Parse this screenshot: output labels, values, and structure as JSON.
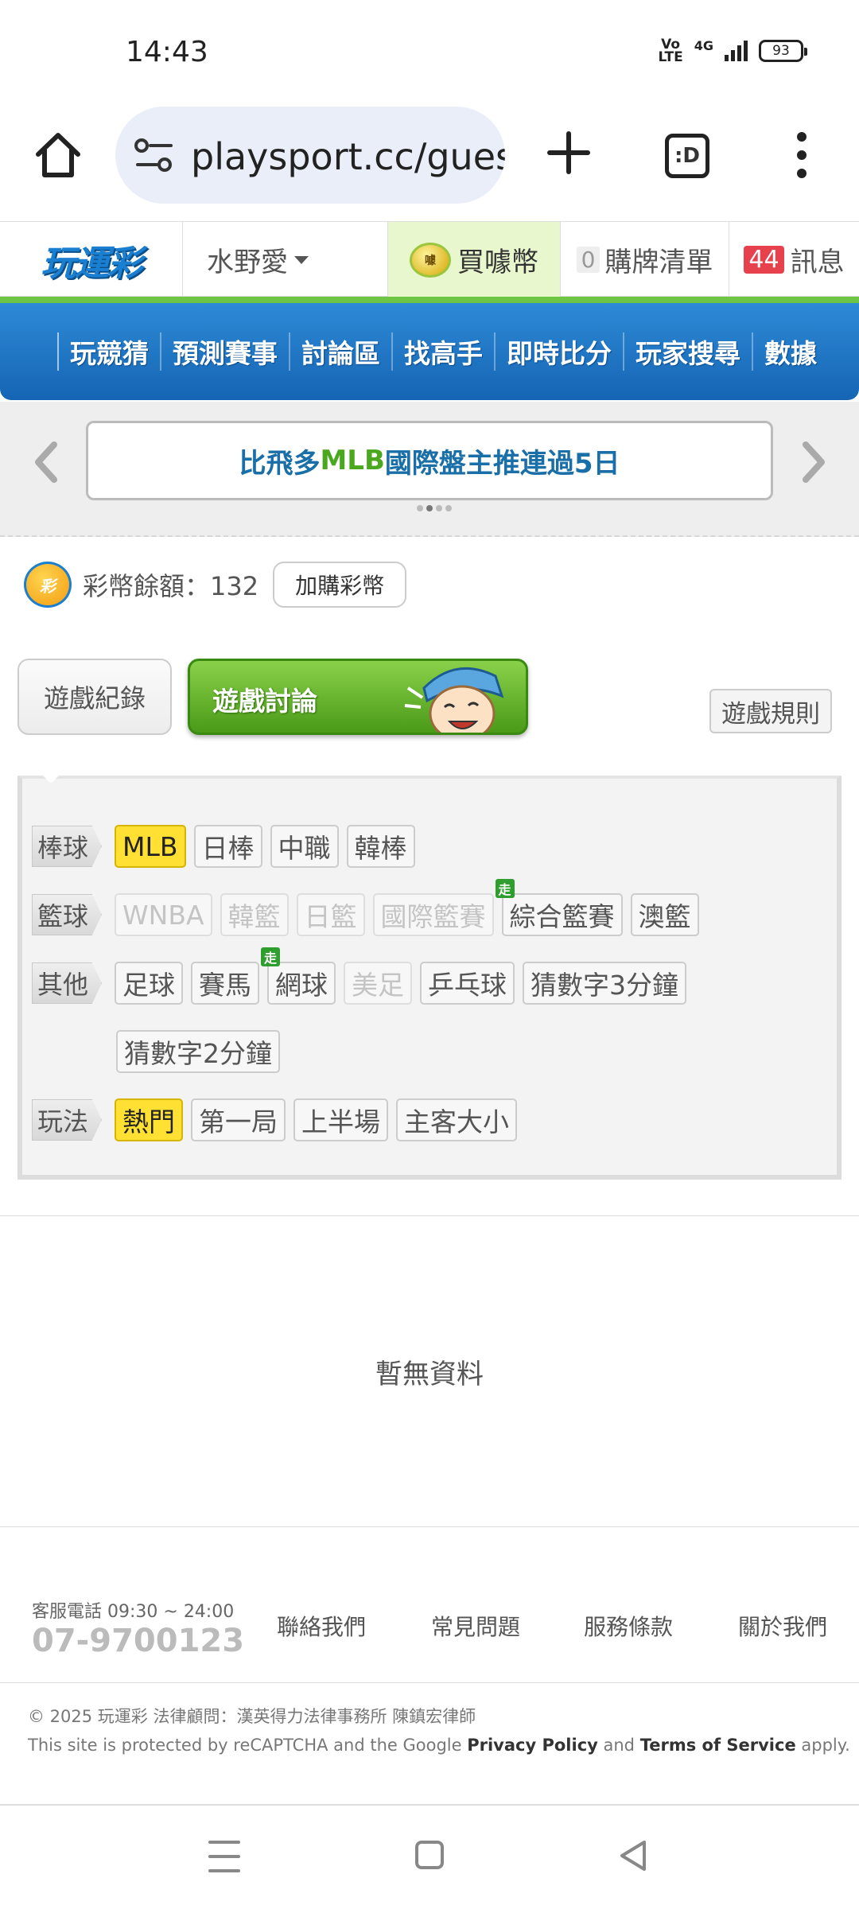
{
  "status_bar": {
    "time": "14:43",
    "network": "4G",
    "volte": "Vo LTE",
    "battery": "93"
  },
  "browser": {
    "url": "playsport.cc/gues",
    "tab_icon_label": ":D"
  },
  "site_header": {
    "logo_text": "玩運彩",
    "user_name": "水野愛",
    "buy_coin_label": "買噱幣",
    "coin_icon_text": "噱",
    "list_count": "0",
    "list_label": "購牌清單",
    "message_count": "44",
    "message_label": "訊息"
  },
  "nav": {
    "items": [
      "玩競猜",
      "預測賽事",
      "討論區",
      "找高手",
      "即時比分",
      "玩家搜尋",
      "數據"
    ]
  },
  "banner": {
    "text_part1": "比飛多 ",
    "text_part2": "MLB",
    "text_part3": " 國際盤主推連過5日"
  },
  "balance": {
    "icon_text": "彩",
    "label": "彩幣餘額：132",
    "buy_more_label": "加購彩幣"
  },
  "tabs": {
    "record": "遊戲紀錄",
    "discuss": "遊戲討論",
    "rules": "遊戲規則"
  },
  "filters": {
    "baseball": {
      "label": "棒球",
      "chips": [
        "MLB",
        "日棒",
        "中職",
        "韓棒"
      ]
    },
    "basketball": {
      "label": "籃球",
      "chips": [
        "WNBA",
        "韓籃",
        "日籃",
        "國際籃賽",
        "綜合籃賽",
        "澳籃"
      ]
    },
    "other": {
      "label": "其他",
      "chips": [
        "足球",
        "賽馬",
        "網球",
        "美足",
        "乒乓球",
        "猜數字3分鐘",
        "猜數字2分鐘"
      ]
    },
    "play": {
      "label": "玩法",
      "chips": [
        "熱門",
        "第一局",
        "上半場",
        "主客大小"
      ]
    },
    "live_badge": "走"
  },
  "empty_message": "暫無資料",
  "footer": {
    "service_label": "客服電話 09:30 ~ 24:00",
    "service_phone": "07-9700123",
    "links": [
      "聯絡我們",
      "常見問題",
      "服務條款",
      "關於我們"
    ],
    "copyright": "© 2025 玩運彩 法律顧問：漢英得力法律事務所 陳鎮宏律師",
    "recaptcha_prefix": "This site is protected by reCAPTCHA and the Google ",
    "privacy": "Privacy Policy",
    "and": " and ",
    "terms": "Terms of Service",
    "apply": " apply."
  }
}
